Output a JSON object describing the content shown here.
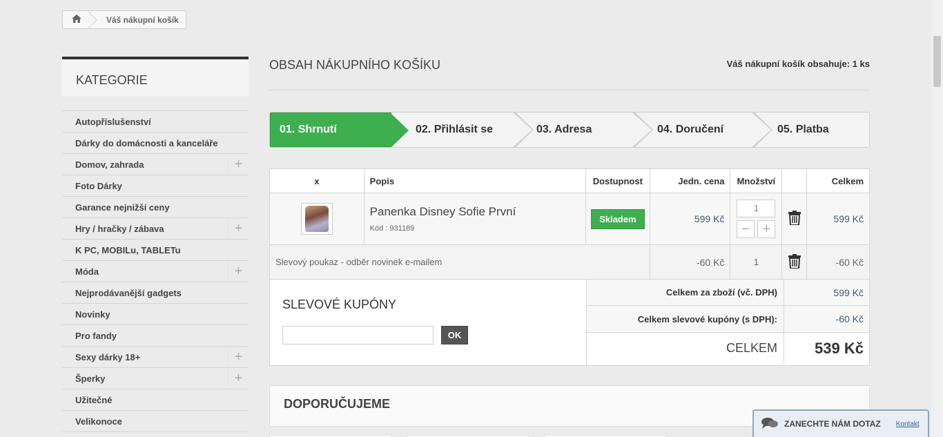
{
  "breadcrumb": {
    "home_icon": "home-icon",
    "current": "Váš nákupní košík"
  },
  "sidebar": {
    "title": "KATEGORIE",
    "items": [
      {
        "label": "Autopříslušenství",
        "expandable": false
      },
      {
        "label": "Dárky do domácnosti a kanceláře",
        "expandable": false
      },
      {
        "label": "Domov, zahrada",
        "expandable": true
      },
      {
        "label": "Foto Dárky",
        "expandable": false
      },
      {
        "label": "Garance nejnižší ceny",
        "expandable": false
      },
      {
        "label": "Hry / hračky / zábava",
        "expandable": true
      },
      {
        "label": "K PC, MOBILu, TABLETu",
        "expandable": false
      },
      {
        "label": "Móda",
        "expandable": true
      },
      {
        "label": "Nejprodávanější gadgets",
        "expandable": false
      },
      {
        "label": "Novinky",
        "expandable": false
      },
      {
        "label": "Pro fandy",
        "expandable": false
      },
      {
        "label": "Sexy dárky 18+",
        "expandable": true
      },
      {
        "label": "Šperky",
        "expandable": true
      },
      {
        "label": "Užitečné",
        "expandable": false
      },
      {
        "label": "Velikonoce",
        "expandable": false
      }
    ]
  },
  "main": {
    "title": "OBSAH NÁKUPNÍHO KOŠÍKU",
    "count_text": "Váš nákupní košík obsahuje: 1 ks",
    "steps": [
      "01. Shrnutí",
      "02. Přihlásit se",
      "03. Adresa",
      "04. Doručení",
      "05. Platba"
    ],
    "active_step": 0
  },
  "cart": {
    "headers": {
      "x": "x",
      "desc": "Popis",
      "avail": "Dostupnost",
      "unit": "Jedn. cena",
      "qty": "Množství",
      "total": "Celkem"
    },
    "product": {
      "name": "Panenka Disney Sofie První",
      "code": "Kód : 931189",
      "availability": "Skladem",
      "unit_price": "599 Kč",
      "quantity": "1",
      "total": "599 Kč"
    },
    "discount": {
      "desc": "Slevový poukaz - odběr novinek e-mailem",
      "unit_price": "-60 Kč",
      "quantity": "1",
      "total": "-60 Kč"
    }
  },
  "coupon": {
    "title": "SLEVOVÉ KUPÓNY",
    "input_value": "",
    "ok_label": "OK"
  },
  "summary": {
    "goods_label": "Celkem za zboží (vč. DPH)",
    "goods_value": "599 Kč",
    "coupons_label": "Celkem slevové kupóny (s DPH):",
    "coupons_value": "-60 Kč",
    "total_label": "CELKEM",
    "total_value": "539 Kč"
  },
  "recommend": {
    "title": "DOPORUČUJEME"
  },
  "contact_widget": {
    "title": "ZANECHTE NÁM DOTAZ",
    "link": "Kontakt"
  },
  "colors": {
    "accent_green": "#3daf4f",
    "price_blue": "#3b5a7a",
    "dark_button": "#555555"
  }
}
